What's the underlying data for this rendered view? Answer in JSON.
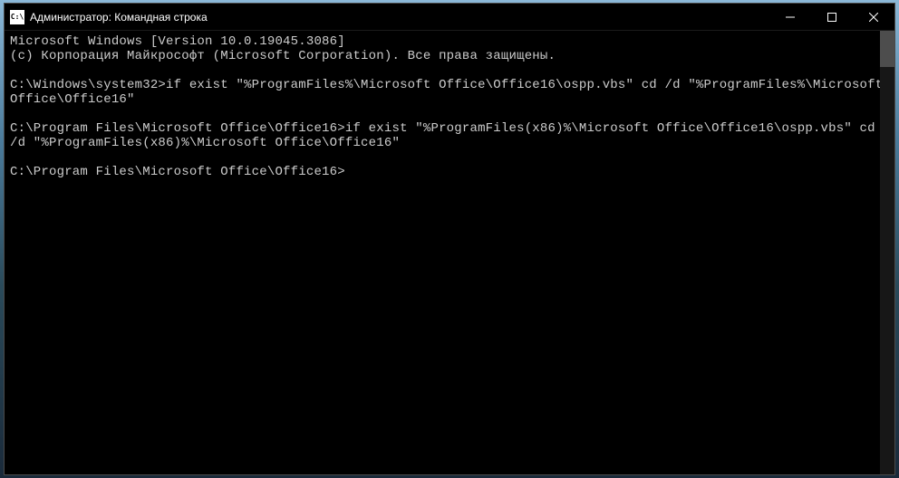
{
  "window": {
    "title": "Администратор: Командная строка",
    "icon_label": "C:\\"
  },
  "terminal": {
    "line1": "Microsoft Windows [Version 10.0.19045.3086]",
    "line2": "(c) Корпорация Майкрософт (Microsoft Corporation). Все права защищены.",
    "blank1": "",
    "line3": "C:\\Windows\\system32>if exist \"%ProgramFiles%\\Microsoft Office\\Office16\\ospp.vbs\" cd /d \"%ProgramFiles%\\Microsoft Office\\Office16\"",
    "blank2": "",
    "line4": "C:\\Program Files\\Microsoft Office\\Office16>if exist \"%ProgramFiles(x86)%\\Microsoft Office\\Office16\\ospp.vbs\" cd /d \"%ProgramFiles(x86)%\\Microsoft Office\\Office16\"",
    "blank3": "",
    "line5": "C:\\Program Files\\Microsoft Office\\Office16>"
  }
}
